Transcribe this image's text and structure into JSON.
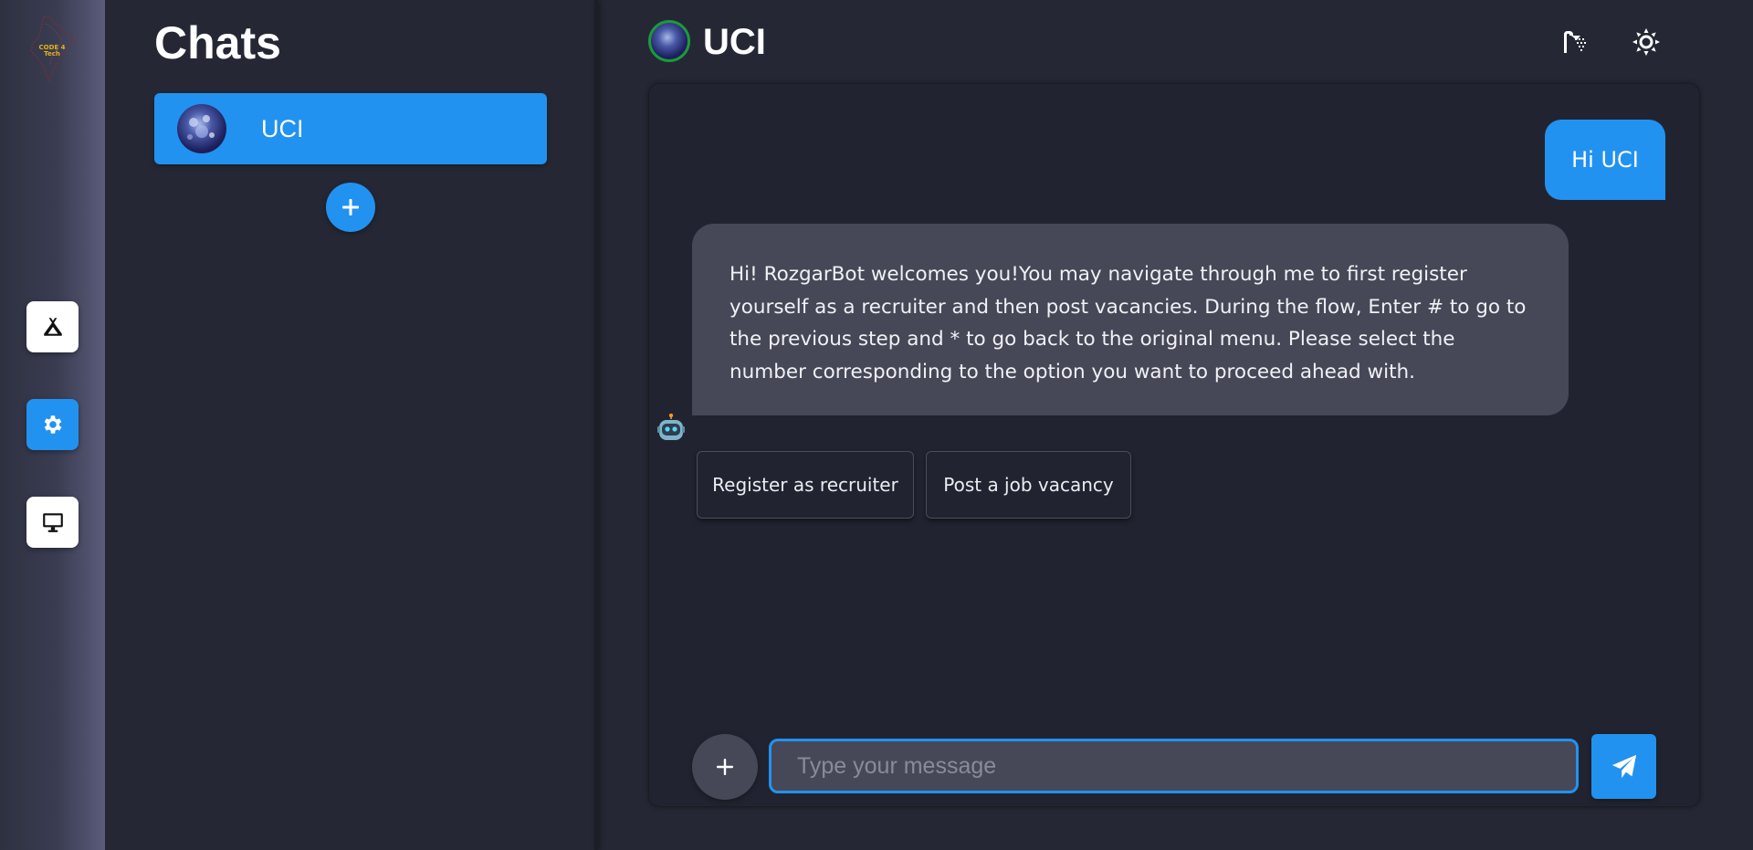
{
  "sidebar": {
    "logo_text_line1": "CODE 4",
    "logo_text_line2": "Tech",
    "nav_icons": [
      "campground-icon",
      "gear-icon",
      "desktop-icon"
    ],
    "active_index": 1
  },
  "chats_panel": {
    "title": "Chats",
    "items": [
      {
        "name": "UCI"
      }
    ]
  },
  "header": {
    "title": "UCI",
    "icons": [
      "shower-icon",
      "sun-icon"
    ]
  },
  "messages": {
    "user": "Hi UCI",
    "bot": "Hi! RozgarBot welcomes you!You may navigate through me to first register yourself as a recruiter and then post vacancies. During the flow, Enter # to go to the previous step and * to go back to the original menu. Please select the number corresponding to the option you want to proceed ahead with.",
    "options": [
      "Register as recruiter",
      "Post a job vacancy"
    ]
  },
  "composer": {
    "placeholder": "Type your message",
    "value": ""
  },
  "colors": {
    "accent": "#2292f0",
    "background": "#252834",
    "bubble_bot": "#464858",
    "online_ring": "#1b9a3a"
  }
}
